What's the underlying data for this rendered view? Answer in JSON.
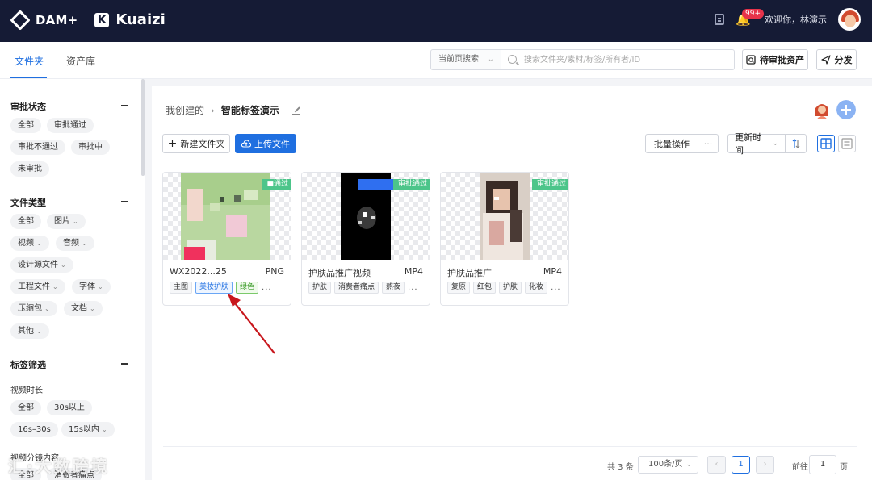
{
  "header": {
    "brand_primary": "DAM+",
    "brand_secondary": "Kuaizi",
    "brand_secondary_mark": "K",
    "notification_count": "99+",
    "welcome_text": "欢迎你，林演示"
  },
  "subnav": {
    "tabs": [
      {
        "label": "文件夹",
        "active": true
      },
      {
        "label": "资产库",
        "active": false
      }
    ],
    "search_scope": "当前页搜索",
    "search_placeholder": "搜索文件夹/素材/标签/所有者/ID",
    "pending_review_label": "待审批资产",
    "share_label": "分发"
  },
  "sidebar": {
    "approval_status": {
      "title": "审批状态",
      "options": [
        "全部",
        "审批通过",
        "审批不通过",
        "审批中",
        "未审批"
      ]
    },
    "file_type": {
      "title": "文件类型",
      "options": [
        "全部",
        "图片",
        "视频",
        "音频",
        "设计源文件",
        "工程文件",
        "字体",
        "压缩包",
        "文档",
        "其他"
      ]
    },
    "tag_filter": {
      "title": "标签筛选",
      "video_duration": {
        "title": "视频时长",
        "options": [
          "全部",
          "30s以上",
          "16s–30s",
          "15s以内"
        ]
      },
      "video_scene": {
        "title": "视频分镜内容",
        "options": [
          "全部",
          "消费者痛点"
        ]
      }
    }
  },
  "main": {
    "breadcrumb": {
      "parent": "我创建的",
      "current": "智能标签演示"
    },
    "new_folder_label": "新建文件夹",
    "upload_label": "上传文件",
    "batch_label": "批量操作",
    "more_label": "···",
    "sort_label": "更新时间",
    "cards": [
      {
        "name": "WX2022...25",
        "type": "PNG",
        "status": "■通过",
        "tags": [
          {
            "text": "主图",
            "style": "plain"
          },
          {
            "text": "美妆护肤",
            "style": "blue"
          },
          {
            "text": "绿色",
            "style": "green"
          }
        ]
      },
      {
        "name": "护肤品推广视频",
        "type": "MP4",
        "status": "审批通过",
        "tags": [
          {
            "text": "护肤",
            "style": "plain"
          },
          {
            "text": "消费者痛点",
            "style": "plain"
          },
          {
            "text": "熬夜",
            "style": "plain"
          }
        ]
      },
      {
        "name": "护肤品推广",
        "type": "MP4",
        "status": "审批通过",
        "tags": [
          {
            "text": "复原",
            "style": "plain"
          },
          {
            "text": "红包",
            "style": "plain"
          },
          {
            "text": "护肤",
            "style": "plain"
          },
          {
            "text": "化妆",
            "style": "plain"
          }
        ]
      }
    ],
    "card_more": "...",
    "pagination": {
      "total_text": "共 3 条",
      "page_size": "100条/页",
      "current_page": "1",
      "goto_label": "前往",
      "goto_value": "1",
      "page_suffix": "页"
    }
  },
  "watermark": "汇·大数跨境",
  "colors": {
    "header_bg": "#151b35",
    "accent": "#1f6fe0",
    "approved": "#4cc58a",
    "badge": "#e8334a"
  },
  "icons": [
    "doc-icon",
    "bell-icon",
    "search-icon",
    "review-icon",
    "send-icon",
    "plus-icon",
    "upload-cloud-icon",
    "sort-icon",
    "grid-view-icon",
    "list-view-icon",
    "pencil-icon",
    "chevron-left-icon",
    "chevron-right-icon"
  ]
}
